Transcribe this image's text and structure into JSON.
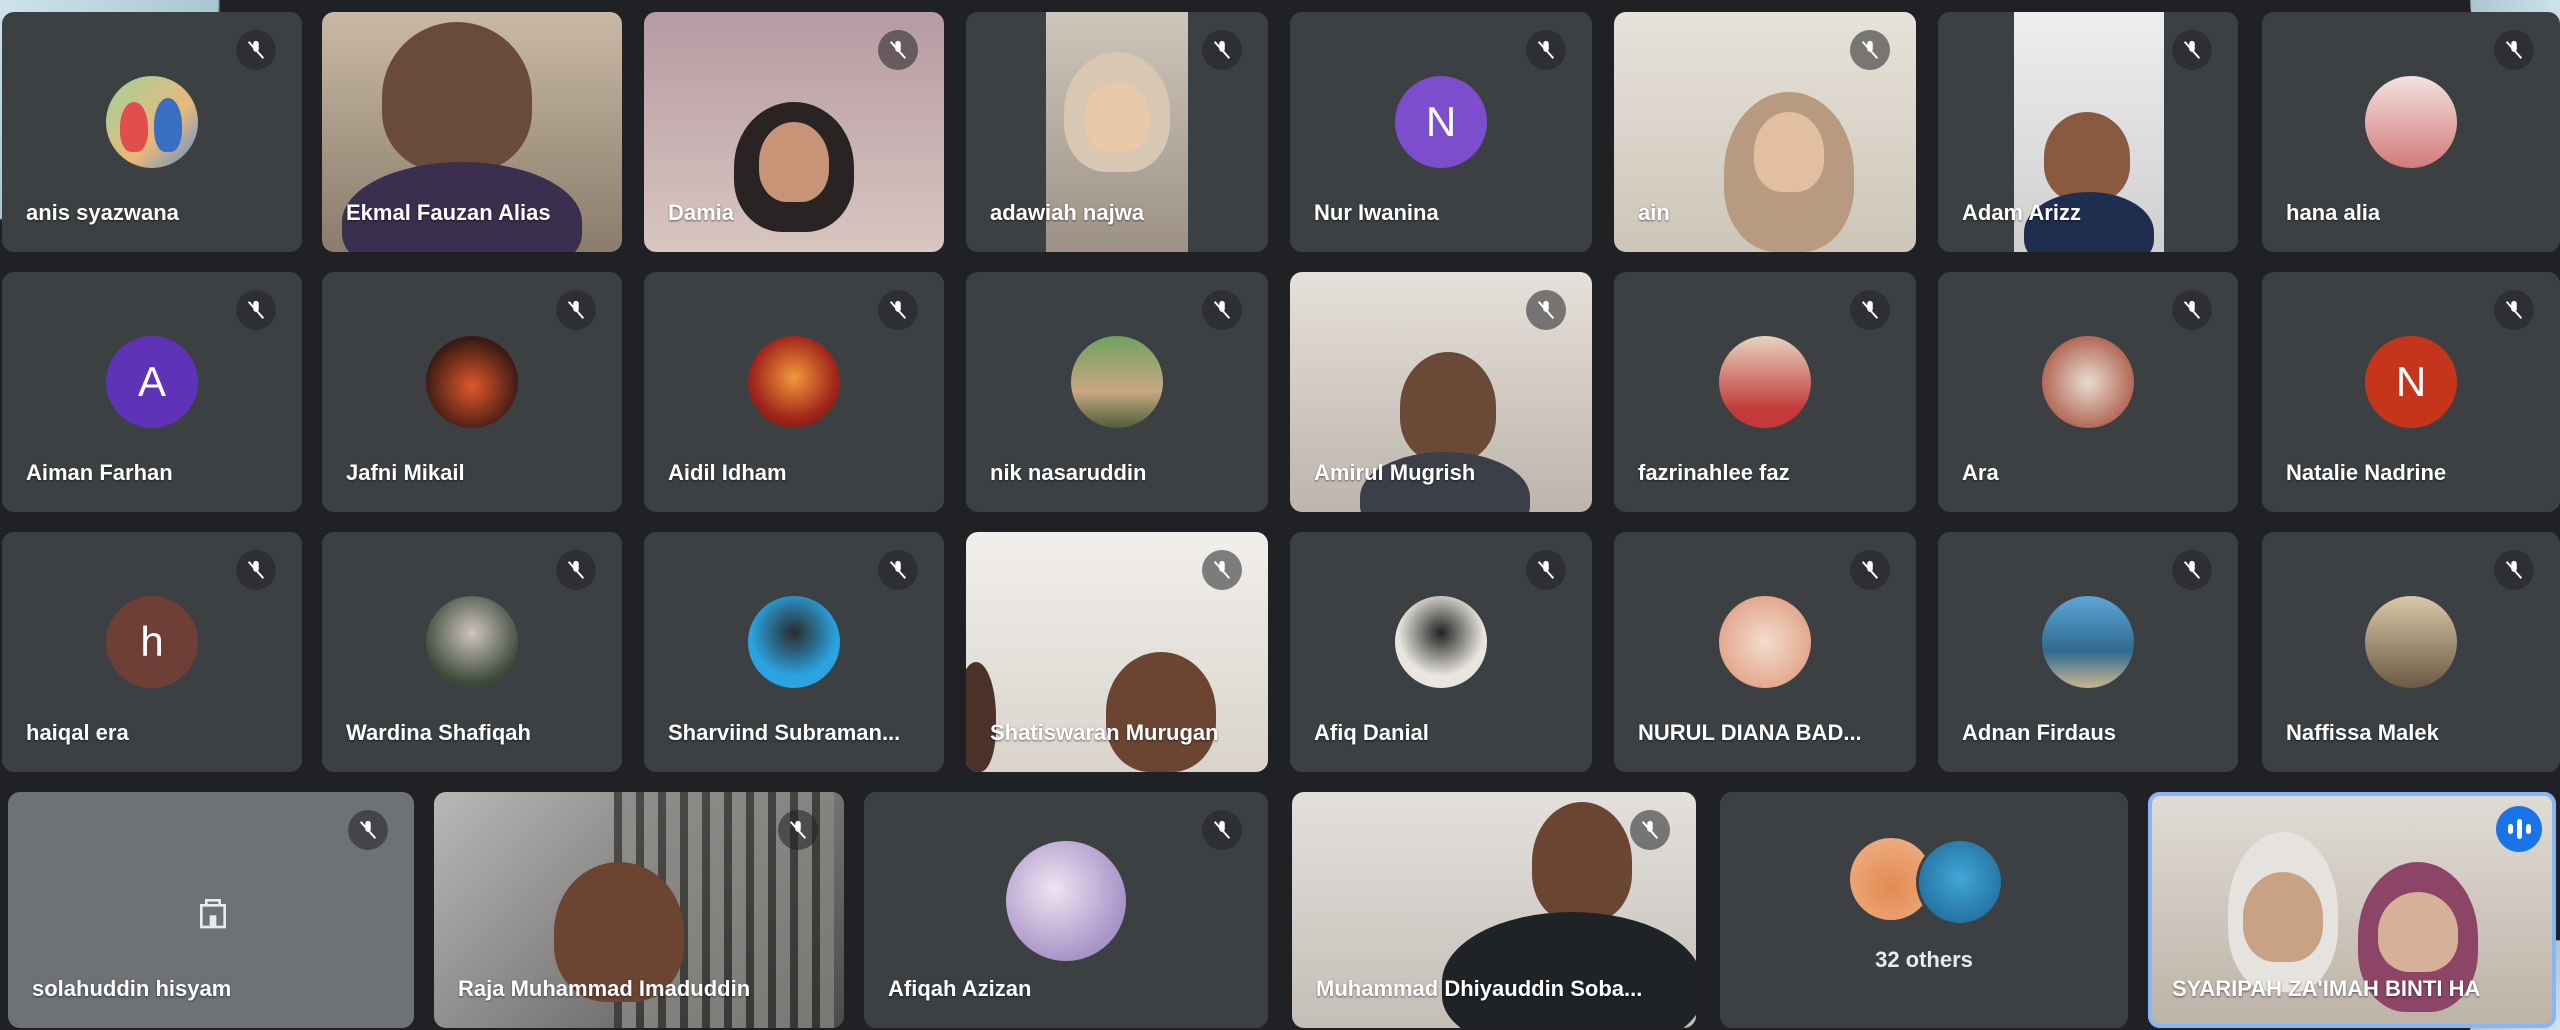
{
  "meeting": {
    "others_count_label": "32 others",
    "accent_color": "#8ab4f8",
    "tile_color": "#3c4043",
    "speaking_color": "#1a73e8"
  },
  "participants": [
    {
      "name": "anis syazwana",
      "type": "image-avatar",
      "muted": true
    },
    {
      "name": "Ekmal Fauzan Alias",
      "type": "video",
      "muted": false
    },
    {
      "name": "Damia",
      "type": "video",
      "muted": true
    },
    {
      "name": "adawiah najwa",
      "type": "video",
      "muted": true
    },
    {
      "name": "Nur Iwanina",
      "type": "letter-avatar",
      "letter": "N",
      "avatar_color": "#7c4dcc",
      "muted": true
    },
    {
      "name": "ain",
      "type": "video",
      "muted": true
    },
    {
      "name": "Adam Arizz",
      "type": "video",
      "muted": true
    },
    {
      "name": "hana alia",
      "type": "image-avatar",
      "muted": true
    },
    {
      "name": "Aiman Farhan",
      "type": "letter-avatar",
      "letter": "A",
      "avatar_color": "#5f33b8",
      "muted": true
    },
    {
      "name": "Jafni Mikail",
      "type": "image-avatar",
      "muted": true
    },
    {
      "name": "Aidil Idham",
      "type": "image-avatar",
      "muted": true
    },
    {
      "name": "nik nasaruddin",
      "type": "image-avatar",
      "muted": true
    },
    {
      "name": "Amirul Mugrish",
      "type": "video",
      "muted": true
    },
    {
      "name": "fazrinahlee faz",
      "type": "image-avatar",
      "muted": true
    },
    {
      "name": "Ara",
      "type": "image-avatar",
      "muted": true
    },
    {
      "name": "Natalie Nadrine",
      "type": "letter-avatar",
      "letter": "N",
      "avatar_color": "#c5351b",
      "muted": true
    },
    {
      "name": "haiqal era",
      "type": "letter-avatar",
      "letter": "h",
      "avatar_color": "#6d3f36",
      "muted": true
    },
    {
      "name": "Wardina Shafiqah",
      "type": "image-avatar",
      "muted": true
    },
    {
      "name": "Sharviind Subraman...",
      "type": "image-avatar",
      "muted": true
    },
    {
      "name": "Shatiswaran Murugan",
      "type": "video",
      "muted": true
    },
    {
      "name": "Afiq Danial",
      "type": "image-avatar",
      "muted": true
    },
    {
      "name": "NURUL DIANA BAD...",
      "type": "image-avatar",
      "muted": true
    },
    {
      "name": "Adnan Firdaus",
      "type": "image-avatar",
      "muted": true
    },
    {
      "name": "Naffissa Malek",
      "type": "image-avatar",
      "muted": true
    },
    {
      "name": "solahuddin hisyam",
      "type": "placeholder",
      "muted": true
    },
    {
      "name": "Raja Muhammad Imaduddin",
      "type": "video",
      "muted": true
    },
    {
      "name": "Afiqah Azizan",
      "type": "image-avatar",
      "muted": true
    },
    {
      "name": "Muhammad Dhiyauddin Soba...",
      "type": "video",
      "muted": true
    },
    {
      "name": "SYARIPAH ZA'IMAH BINTI HA",
      "type": "video",
      "muted": false,
      "speaking": true
    }
  ]
}
